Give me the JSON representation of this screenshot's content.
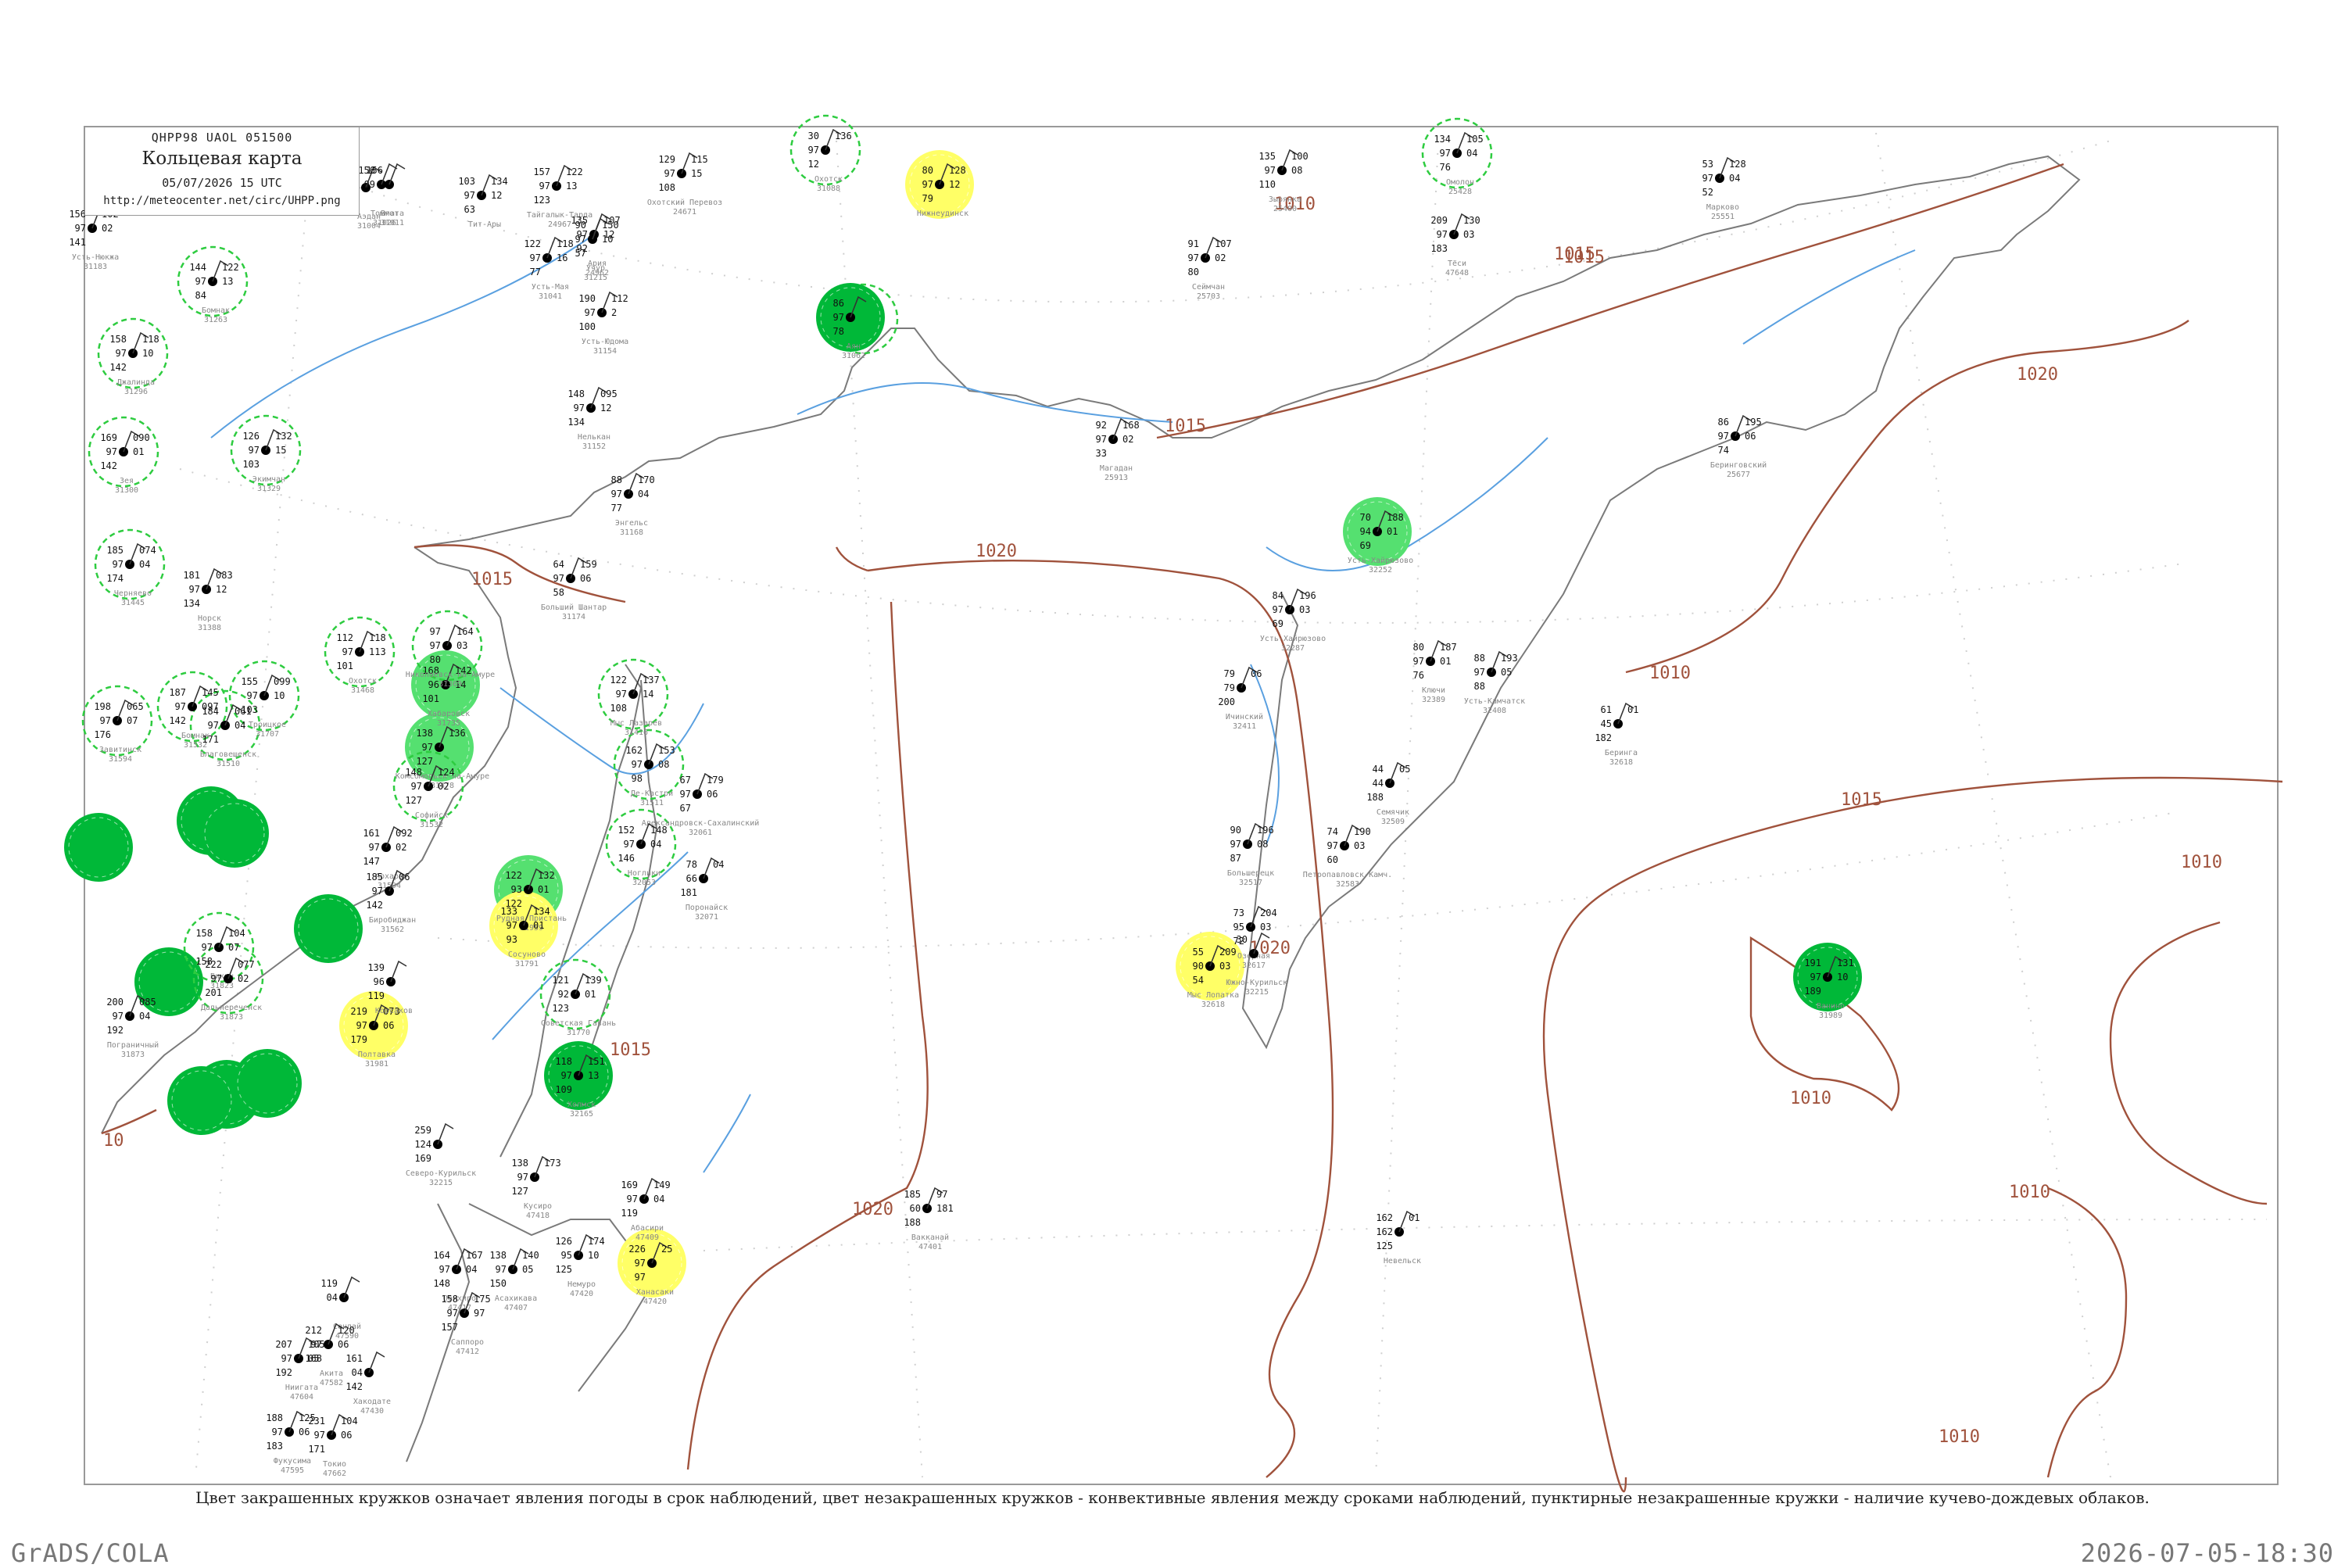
{
  "header": {
    "code": "QHPP98  UAOL  051500",
    "title": "Кольцевая карта",
    "datetime": "05/07/2026 15 UTC",
    "url": "http://meteocenter.net/circ/UHPP.png"
  },
  "caption": "Цвет закрашенных кружков означает явления погоды в срок наблюдений, цвет незакрашенных кружков - конвективные явления между сроками наблюдений, пунктирные незакрашенные кружки - наличие кучево-дождевых облаков.",
  "footer": {
    "left": "GrADS/COLA",
    "right": "2026-07-05-18:30"
  },
  "isobars": [
    {
      "label": "1010"
    },
    {
      "label": "1015"
    },
    {
      "label": "1020"
    }
  ],
  "isobar_label_texts": [
    "1010",
    "1015",
    "1015",
    "1015",
    "1020",
    "1020",
    "1020",
    "1020",
    "1015",
    "1010",
    "1010",
    "1010",
    "1010",
    "1010",
    "1015",
    "1015",
    "10"
  ],
  "colors": {
    "isobar": "#a0523c",
    "coast": "#7a7a7a",
    "river": "#5aa0e0",
    "circle_green_dark": "#00b838",
    "circle_green_light": "#55e070",
    "circle_yellow": "#ffff66",
    "dashed_circle": "#2ecc40",
    "station_name": "#888888"
  },
  "stations": [
    {
      "name": "Усть-Нюкжа",
      "id": "31183",
      "v1": "156",
      "v2": "97",
      "v3": "141",
      "v4": "102",
      "v5": "02"
    },
    {
      "name": "Аэдан",
      "id": "31004",
      "v1": "70",
      "v2": "97",
      "v3": "72"
    },
    {
      "name": "Томмот",
      "id": "31026",
      "v1": "156",
      "v2": "09"
    },
    {
      "name": "Вгата",
      "id": "31011",
      "v1": "156"
    },
    {
      "name": "Тит-Ары",
      "v1": "103",
      "v2": "97",
      "v3": "63",
      "v4": "134",
      "v5": "12"
    },
    {
      "name": "Тайгалык-Тарда",
      "id": "24967",
      "v1": "157",
      "v2": "97",
      "v3": "123",
      "v4": "122",
      "v5": "13"
    },
    {
      "name": "Ария",
      "id": "24962",
      "v1": "135",
      "v2": "97",
      "v3": "92",
      "v4": "107",
      "v5": "12"
    },
    {
      "name": "Охотский Перевоз",
      "id": "24671",
      "v1": "129",
      "v2": "97",
      "v3": "108",
      "v4": "115",
      "v5": "15"
    },
    {
      "name": "Усть-Мая",
      "id": "31041",
      "v1": "122",
      "v2": "97",
      "v3": "77",
      "v4": "118",
      "v5": "16"
    },
    {
      "name": "Учур",
      "id": "31215",
      "v1": "90",
      "v2": "97",
      "v3": "57",
      "v4": "150",
      "v5": "10"
    },
    {
      "name": "Усть-Юдома",
      "id": "31154",
      "v1": "190",
      "v2": "97",
      "v3": "100",
      "v4": "112",
      "v5": "2"
    },
    {
      "name": "Нелькан",
      "id": "31152",
      "v1": "148",
      "v2": "97",
      "v3": "134",
      "v4": "095",
      "v5": "12"
    },
    {
      "name": "Бомнак",
      "id": "31263",
      "v1": "144",
      "v2": "97",
      "v3": "84",
      "v4": "122",
      "v5": "13"
    },
    {
      "name": "Джалинда",
      "id": "31296",
      "v1": "158",
      "v2": "97",
      "v3": "142",
      "v4": "118",
      "v5": "10"
    },
    {
      "name": "Зея",
      "id": "31300",
      "v1": "169",
      "v2": "97",
      "v3": "142",
      "v4": "090",
      "v5": "01"
    },
    {
      "name": "Экимчан",
      "id": "31329",
      "v1": "126",
      "v2": "97",
      "v3": "103",
      "v4": "132",
      "v5": "15"
    },
    {
      "name": "Черняево",
      "id": "31445",
      "v1": "185",
      "v2": "97",
      "v3": "174",
      "v4": "074",
      "v5": "04"
    },
    {
      "name": "Норск",
      "id": "31388",
      "v1": "181",
      "v2": "97",
      "v3": "134",
      "v4": "083",
      "v5": "12"
    },
    {
      "name": "Охотск",
      "id": "31088",
      "v1": "30",
      "v2": "97",
      "v3": "12",
      "v4": "136"
    },
    {
      "name": "Нижнеудинск",
      "v1": "80",
      "v2": "97",
      "v3": "79",
      "v4": "128",
      "v5": "12"
    },
    {
      "name": "Аян",
      "id": "31062",
      "v1": "86",
      "v2": "97",
      "v3": "78"
    },
    {
      "name": "Магадан",
      "id": "25913",
      "v1": "92",
      "v2": "97",
      "v3": "33",
      "v4": "168",
      "v5": "02"
    },
    {
      "name": "Сеймчан",
      "id": "25703",
      "v1": "91",
      "v2": "97",
      "v3": "80",
      "v4": "107",
      "v5": "02"
    },
    {
      "name": "Зырянка",
      "id": "25400",
      "v1": "135",
      "v2": "97",
      "v3": "110",
      "v4": "100",
      "v5": "08"
    },
    {
      "name": "Омолон",
      "id": "25428",
      "v1": "134",
      "v2": "97",
      "v3": "76",
      "v4": "105",
      "v5": "04"
    },
    {
      "name": "Марково",
      "id": "25551",
      "v1": "53",
      "v2": "97",
      "v3": "52",
      "v4": "128",
      "v5": "04"
    },
    {
      "name": "Беринговский",
      "id": "25677",
      "v1": "86",
      "v2": "97",
      "v3": "74",
      "v4": "195",
      "v5": "06"
    },
    {
      "name": "Энгельс",
      "id": "31168",
      "v1": "88",
      "v2": "97",
      "v3": "77",
      "v4": "170",
      "v5": "04"
    },
    {
      "name": "Больший Шантар",
      "id": "31174",
      "v1": "64",
      "v2": "97",
      "v3": "58",
      "v4": "159",
      "v5": "06"
    },
    {
      "name": "Усть-Хайрюзово",
      "id": "32252",
      "v1": "70",
      "v2": "94",
      "v3": "69",
      "v4": "188",
      "v5": "01"
    },
    {
      "name": "Усть-Хайрюзово",
      "id": "32287",
      "v1": "84",
      "v2": "97",
      "v3": "69",
      "v4": "196",
      "v5": "03"
    },
    {
      "name": "Ключи",
      "id": "32389",
      "v1": "80",
      "v2": "97",
      "v3": "76",
      "v4": "187",
      "v5": "01"
    },
    {
      "name": "Усть-Камчатск",
      "id": "32408",
      "v1": "88",
      "v2": "97",
      "v3": "88",
      "v4": "193",
      "v5": "05"
    },
    {
      "name": "Ичинский",
      "id": "32411",
      "v1": "79",
      "v2": "79",
      "v3": "200",
      "v4": "06"
    },
    {
      "name": "Беринга",
      "id": "32618",
      "v1": "61",
      "v2": "45",
      "v3": "182",
      "v4": "01"
    },
    {
      "name": "Семячик",
      "id": "32509",
      "v1": "44",
      "v2": "44",
      "v3": "188",
      "v4": "05"
    },
    {
      "name": "Большерецк",
      "id": "32517",
      "v1": "90",
      "v2": "97",
      "v3": "87",
      "v4": "196",
      "v5": "08"
    },
    {
      "name": "Петропавловск-Камч.",
      "id": "32583",
      "v1": "74",
      "v2": "97",
      "v3": "60",
      "v4": "190",
      "v5": "03"
    },
    {
      "name": "Озерная",
      "id": "32617",
      "v1": "73",
      "v2": "95",
      "v3": "72",
      "v4": "204",
      "v5": "03"
    },
    {
      "name": "Мыс Лопатка",
      "id": "32618",
      "v1": "55",
      "v2": "90",
      "v3": "54",
      "v4": "209",
      "v5": "03"
    },
    {
      "name": "Южно-Курильск",
      "id": "32215",
      "v1": "30"
    },
    {
      "name": "Ванино",
      "id": "31989",
      "v1": "191",
      "v2": "97",
      "v3": "189",
      "v4": "131",
      "v5": "10"
    },
    {
      "name": "Хабаровск",
      "id": "31735",
      "v1": "168",
      "v2": "96",
      "v3": "101",
      "v4": "142",
      "v5": "14"
    },
    {
      "name": "Николаевск-на-Амуре",
      "id": "31369",
      "v1": "97",
      "v2": "97",
      "v3": "80",
      "v4": "164",
      "v5": "03"
    },
    {
      "name": "Охотск",
      "id": "31468",
      "v1": "112",
      "v2": "97",
      "v3": "101",
      "v4": "118",
      "v5": "113"
    },
    {
      "name": "Комсомольск-на-Амуре",
      "id": "31478",
      "v1": "138",
      "v2": "97",
      "v3": "127",
      "v4": "136"
    },
    {
      "name": "Софийск",
      "id": "31532",
      "v1": "148",
      "v2": "97",
      "v3": "127",
      "v4": "124",
      "v5": "02"
    },
    {
      "name": "Мыс Лазарев",
      "id": "31416",
      "v1": "122",
      "v2": "97",
      "v3": "108",
      "v4": "137",
      "v5": "14"
    },
    {
      "name": "Де-Кастри",
      "id": "31511",
      "v1": "162",
      "v2": "97",
      "v3": "98",
      "v4": "153",
      "v5": "08"
    },
    {
      "name": "Александровск-Сахалинский",
      "id": "32061",
      "v1": "67",
      "v2": "97",
      "v3": "67",
      "v4": "179",
      "v5": "06"
    },
    {
      "name": "Ноглики",
      "id": "32053",
      "v1": "152",
      "v2": "97",
      "v3": "146",
      "v4": "148",
      "v5": "04"
    },
    {
      "name": "Поронайск",
      "id": "32071",
      "v1": "78",
      "v2": "66",
      "v3": "181",
      "v4": "04"
    },
    {
      "name": "Троицкое",
      "id": "31707",
      "v1": "155",
      "v2": "97",
      "v3": "103",
      "v4": "099",
      "v5": "10"
    },
    {
      "name": "Бомнак",
      "id": "31532",
      "v1": "187",
      "v2": "97",
      "v3": "142",
      "v4": "145",
      "v5": "097"
    },
    {
      "name": "Завитинск",
      "id": "31594",
      "v1": "198",
      "v2": "97",
      "v3": "176",
      "v4": "065",
      "v5": "07"
    },
    {
      "name": "Благовещенск",
      "id": "31510",
      "v1": "184",
      "v2": "97",
      "v3": "171",
      "v4": "061",
      "v5": "04"
    },
    {
      "name": "Архара",
      "id": "31594",
      "v1": "161",
      "v2": "97",
      "v3": "147",
      "v4": "092",
      "v5": "02"
    },
    {
      "name": "Биробиджан",
      "id": "31562",
      "v1": "185",
      "v2": "97",
      "v3": "142",
      "v4": "06"
    },
    {
      "name": "Бикин",
      "id": "31823",
      "v1": "158",
      "v2": "97",
      "v3": "158",
      "v4": "104",
      "v5": "07"
    },
    {
      "name": "Дальнереченск",
      "id": "31873",
      "v1": "222",
      "v2": "97",
      "v3": "201",
      "v4": "077",
      "v5": "02"
    },
    {
      "name": "Пограничный",
      "id": "31873",
      "v1": "200",
      "v2": "97",
      "v3": "192",
      "v4": "085",
      "v5": "04"
    },
    {
      "name": "Полтавка",
      "id": "31981",
      "v1": "219",
      "v2": "97",
      "v3": "179",
      "v4": "073",
      "v5": "06"
    },
    {
      "name": "Рудная Пристань",
      "id": "31959",
      "v1": "122",
      "v2": "93",
      "v3": "122",
      "v4": "132",
      "v5": "01"
    },
    {
      "name": "Сосуново",
      "id": "31791",
      "v1": "133",
      "v2": "97",
      "v3": "93",
      "v4": "134",
      "v5": "01"
    },
    {
      "name": "Советская Гавань",
      "id": "31770",
      "v1": "121",
      "v2": "92",
      "v3": "123",
      "v4": "139",
      "v5": "01"
    },
    {
      "name": "Холмск",
      "id": "32165",
      "v1": "118",
      "v2": "97",
      "v3": "109",
      "v4": "151",
      "v5": "13"
    },
    {
      "name": "Корсаков",
      "v1": "139",
      "v2": "96",
      "v3": "119"
    },
    {
      "name": "Невельск",
      "v1": "162",
      "v2": "162",
      "v3": "125",
      "v4": "01"
    },
    {
      "name": "Северо-Курильск",
      "id": "32215",
      "v1": "259",
      "v2": "124",
      "v3": "169"
    },
    {
      "name": "Вакканай",
      "id": "47401",
      "v1": "185",
      "v2": "60",
      "v3": "188",
      "v4": "97",
      "v5": "181"
    },
    {
      "name": "Ханасаки",
      "id": "47420",
      "v1": "226",
      "v2": "97",
      "v3": "97",
      "v4": "25"
    },
    {
      "name": "Немуро",
      "id": "47420",
      "v1": "126",
      "v2": "95",
      "v3": "125",
      "v4": "174",
      "v5": "10"
    },
    {
      "name": "Абасири",
      "id": "47409",
      "v1": "169",
      "v2": "97",
      "v3": "119",
      "v4": "149",
      "v5": "04"
    },
    {
      "name": "Кусиро",
      "id": "47418",
      "v1": "138",
      "v2": "97",
      "v3": "127",
      "v4": "173"
    },
    {
      "name": "Асахикава",
      "id": "47407",
      "v1": "138",
      "v2": "97",
      "v3": "150",
      "v4": "140",
      "v5": "05"
    },
    {
      "name": "Обихиро",
      "id": "47417",
      "v1": "164",
      "v2": "97",
      "v3": "148",
      "v4": "167",
      "v5": "04"
    },
    {
      "name": "Саппоро",
      "id": "47412",
      "v1": "158",
      "v2": "97",
      "v3": "157",
      "v4": "175",
      "v5": "97"
    },
    {
      "name": "Хакодате",
      "id": "47430",
      "v1": "161",
      "v2": "04",
      "v3": "142"
    },
    {
      "name": "Сендай",
      "id": "47590",
      "v1": "119",
      "v2": "04"
    },
    {
      "name": "Акита",
      "id": "47582",
      "v1": "212",
      "v2": "97",
      "v3": "168",
      "v4": "120",
      "v5": "06"
    },
    {
      "name": "Ниигата",
      "id": "47604",
      "v1": "207",
      "v2": "97",
      "v3": "192",
      "v4": "105",
      "v5": "05"
    },
    {
      "name": "Фукусима",
      "id": "47595",
      "v1": "188",
      "v2": "97",
      "v3": "183",
      "v4": "125",
      "v5": "06"
    },
    {
      "name": "Токио",
      "id": "47662",
      "v1": "231",
      "v2": "97",
      "v3": "171",
      "v4": "104",
      "v5": "06"
    },
    {
      "name": "Тёси",
      "id": "47648",
      "v1": "209",
      "v2": "97",
      "v3": "183",
      "v4": "130",
      "v5": "03"
    }
  ]
}
